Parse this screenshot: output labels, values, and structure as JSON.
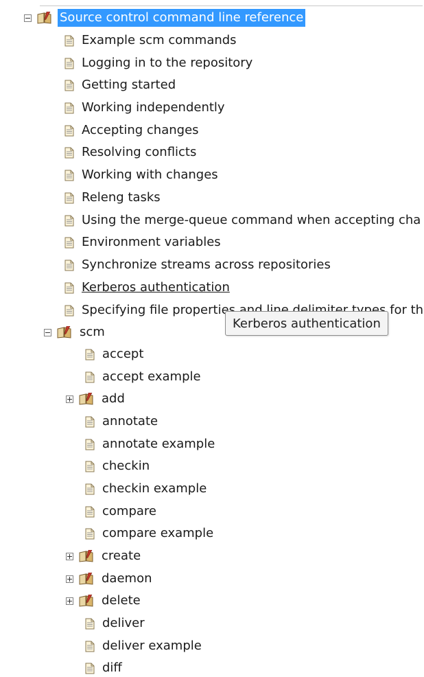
{
  "tree": {
    "root": {
      "label": "Source control command line reference",
      "icon": "book-icon",
      "expanded": true,
      "selected": true
    },
    "children": [
      {
        "label": "Example scm commands",
        "icon": "page-icon"
      },
      {
        "label": "Logging in to the repository",
        "icon": "page-icon"
      },
      {
        "label": "Getting started",
        "icon": "page-icon"
      },
      {
        "label": "Working independently",
        "icon": "page-icon"
      },
      {
        "label": "Accepting changes",
        "icon": "page-icon"
      },
      {
        "label": "Resolving conflicts",
        "icon": "page-icon"
      },
      {
        "label": "Working with changes",
        "icon": "page-icon"
      },
      {
        "label": "Releng tasks",
        "icon": "page-icon"
      },
      {
        "label": "Using the merge-queue command when accepting cha",
        "icon": "page-icon"
      },
      {
        "label": "Environment variables",
        "icon": "page-icon"
      },
      {
        "label": "Synchronize streams across repositories",
        "icon": "page-icon"
      },
      {
        "label": "Kerberos authentication",
        "icon": "page-icon",
        "hovered": true
      },
      {
        "label": "Specifying file properties and line delimiter types for th",
        "icon": "page-icon"
      }
    ],
    "scm": {
      "label": "scm",
      "icon": "book-icon",
      "expanded": true,
      "children": [
        {
          "label": "accept",
          "icon": "page-icon"
        },
        {
          "label": "accept example",
          "icon": "page-icon"
        },
        {
          "label": "add",
          "icon": "book-icon",
          "expandable": true
        },
        {
          "label": "annotate",
          "icon": "page-icon"
        },
        {
          "label": "annotate example",
          "icon": "page-icon"
        },
        {
          "label": "checkin",
          "icon": "page-icon"
        },
        {
          "label": "checkin example",
          "icon": "page-icon"
        },
        {
          "label": "compare",
          "icon": "page-icon"
        },
        {
          "label": "compare example",
          "icon": "page-icon"
        },
        {
          "label": "create",
          "icon": "book-icon",
          "expandable": true
        },
        {
          "label": "daemon",
          "icon": "book-icon",
          "expandable": true
        },
        {
          "label": "delete",
          "icon": "book-icon",
          "expandable": true
        },
        {
          "label": "deliver",
          "icon": "page-icon"
        },
        {
          "label": "deliver example",
          "icon": "page-icon"
        },
        {
          "label": "diff",
          "icon": "page-icon"
        }
      ]
    }
  },
  "tooltip": {
    "text": "Kerberos authentication"
  },
  "colors": {
    "selection": "#3399ff",
    "selection_text": "#ffffff",
    "tooltip_bg": "#f4f4f4"
  }
}
